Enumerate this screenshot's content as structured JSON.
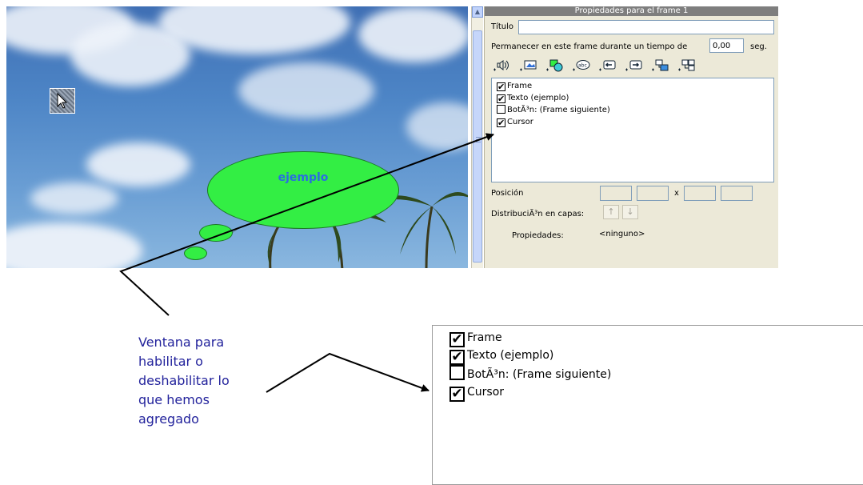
{
  "panel": {
    "title": "Propiedades para el frame 1",
    "titulo_label": "Título",
    "titulo_value": "",
    "stay_label": "Permanecer en este frame durante un tiempo de",
    "stay_value": "0,00",
    "stay_unit": "seg.",
    "toolbar_icons": [
      "add-sound-icon",
      "add-image-icon",
      "add-shape-icon",
      "add-text-icon",
      "add-left-arrow-icon",
      "add-right-arrow-icon",
      "add-link-icon",
      "add-group-icon"
    ],
    "items": [
      {
        "label": "Frame",
        "checked": true
      },
      {
        "label": "Texto (ejemplo)",
        "checked": true
      },
      {
        "label": "BotÃ³n: (Frame siguiente)",
        "checked": false
      },
      {
        "label": "Cursor",
        "checked": true
      }
    ],
    "posicion_label": "Posición",
    "posicion_sep": "x",
    "distribucion_label": "DistribuciÃ³n en capas:",
    "propiedades_label": "Propiedades:",
    "propiedades_value": "<ninguno>"
  },
  "canvas": {
    "bubble_text": "ejemplo",
    "bubble_color": "#33ee44",
    "bubble_text_color": "#2a6ee0"
  },
  "zoom": {
    "items": [
      {
        "label": "Frame",
        "checked": true
      },
      {
        "label": "Texto (ejemplo)",
        "checked": true
      },
      {
        "label": "BotÃ³n: (Frame siguiente)",
        "checked": false
      },
      {
        "label": "Cursor",
        "checked": true
      }
    ]
  },
  "annotation": {
    "lines": [
      "Ventana para",
      "habilitar o",
      "deshabilitar lo",
      "que hemos",
      "agregado"
    ],
    "color": "#23239c"
  },
  "check_mark": "✔"
}
